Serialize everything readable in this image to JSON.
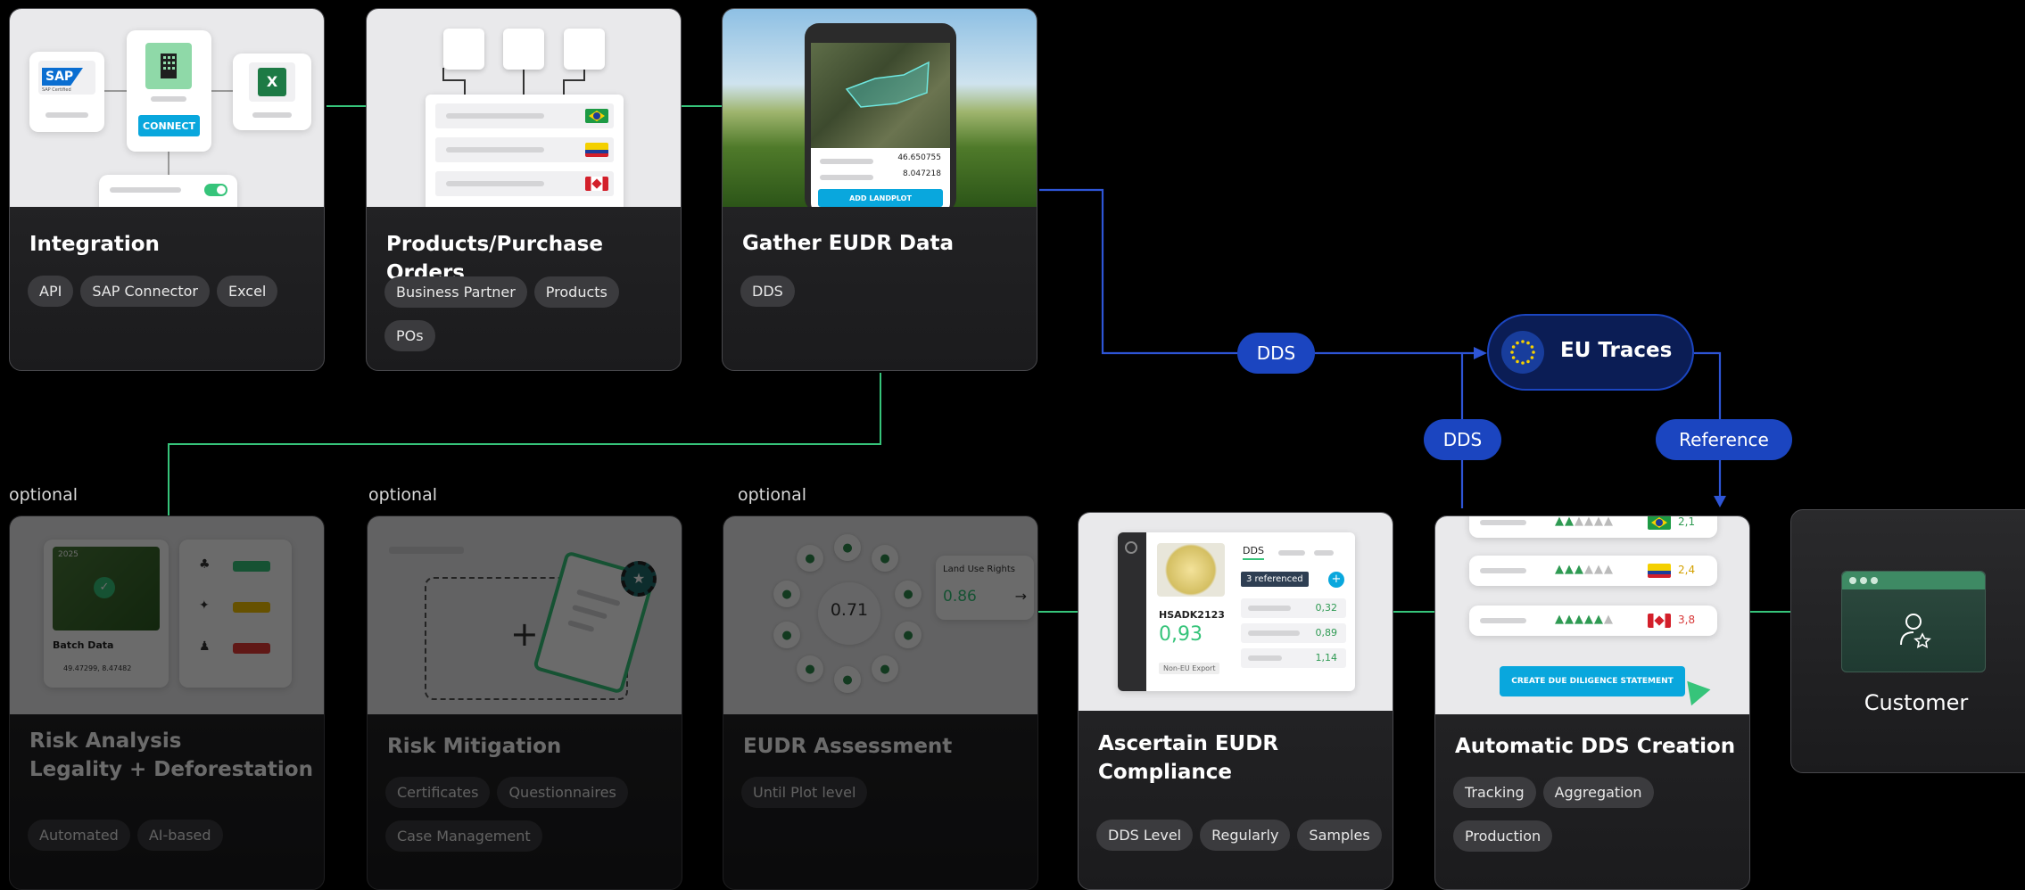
{
  "cards": {
    "integration": {
      "title": "Integration",
      "tags": [
        "API",
        "SAP Connector",
        "Excel"
      ],
      "thumb": {
        "sap_logo": "SAP",
        "sap_sub": "SAP Certified",
        "connect_label": "CONNECT",
        "excel_letter": "X"
      }
    },
    "products": {
      "title": "Products/Purchase Orders",
      "tags": [
        "Business Partner",
        "Products",
        "POs"
      ],
      "thumb": {
        "flags": [
          "brazil",
          "colombia",
          "canada"
        ]
      }
    },
    "gather": {
      "title": "Gather EUDR Data",
      "tags": [
        "DDS"
      ],
      "thumb": {
        "coord_1": "46.650755",
        "coord_2": "8.047218",
        "add_label": "ADD LANDPLOT"
      }
    },
    "risk_analysis": {
      "optional_label": "optional",
      "title_line1": "Risk Analysis",
      "title_line2": "Legality + Deforestation",
      "tags": [
        "Automated",
        "AI-based"
      ],
      "thumb": {
        "year": "2025",
        "batch_label": "Batch Data",
        "batch_coords": "49.47299, 8.47482"
      }
    },
    "risk_mitigation": {
      "optional_label": "optional",
      "title": "Risk Mitigation",
      "tags": [
        "Certificates",
        "Questionnaires",
        "Case Management"
      ]
    },
    "eudr_assessment": {
      "optional_label": "optional",
      "title": "EUDR Assessment",
      "tags": [
        "Until Plot level"
      ],
      "thumb": {
        "score": "0.71",
        "land_use_label": "Land Use Rights",
        "land_use_value": "0.86"
      }
    },
    "ascertain": {
      "title_line1": "Ascertain EUDR",
      "title_line2": "Compliance",
      "tags": [
        "DDS Level",
        "Regularly",
        "Samples"
      ],
      "thumb": {
        "dds_tab": "DDS",
        "referenced": "3 referenced",
        "code": "HSADK2123",
        "score": "0,93",
        "export_label": "Non-EU Export",
        "values": [
          "0,32",
          "0,89",
          "1,14"
        ]
      }
    },
    "auto_dds": {
      "title": "Automatic DDS Creation",
      "tags": [
        "Tracking",
        "Aggregation",
        "Production"
      ],
      "thumb": {
        "rows": [
          {
            "flag": "brazil",
            "value": "2,1"
          },
          {
            "flag": "colombia",
            "value": "2,4"
          },
          {
            "flag": "canada",
            "value": "3,8"
          }
        ],
        "button": "CREATE DUE DILIGENCE STATEMENT"
      }
    },
    "customer": {
      "label": "Customer"
    }
  },
  "eu_traces": {
    "label": "EU Traces"
  },
  "connectors": {
    "dds_top": "DDS",
    "dds_mid": "DDS",
    "reference": "Reference"
  },
  "colors": {
    "green": "#36c47a",
    "blue": "#2e55d6",
    "pill": "#1b45c0",
    "card": "#222224",
    "cyan": "#09a7dd"
  }
}
